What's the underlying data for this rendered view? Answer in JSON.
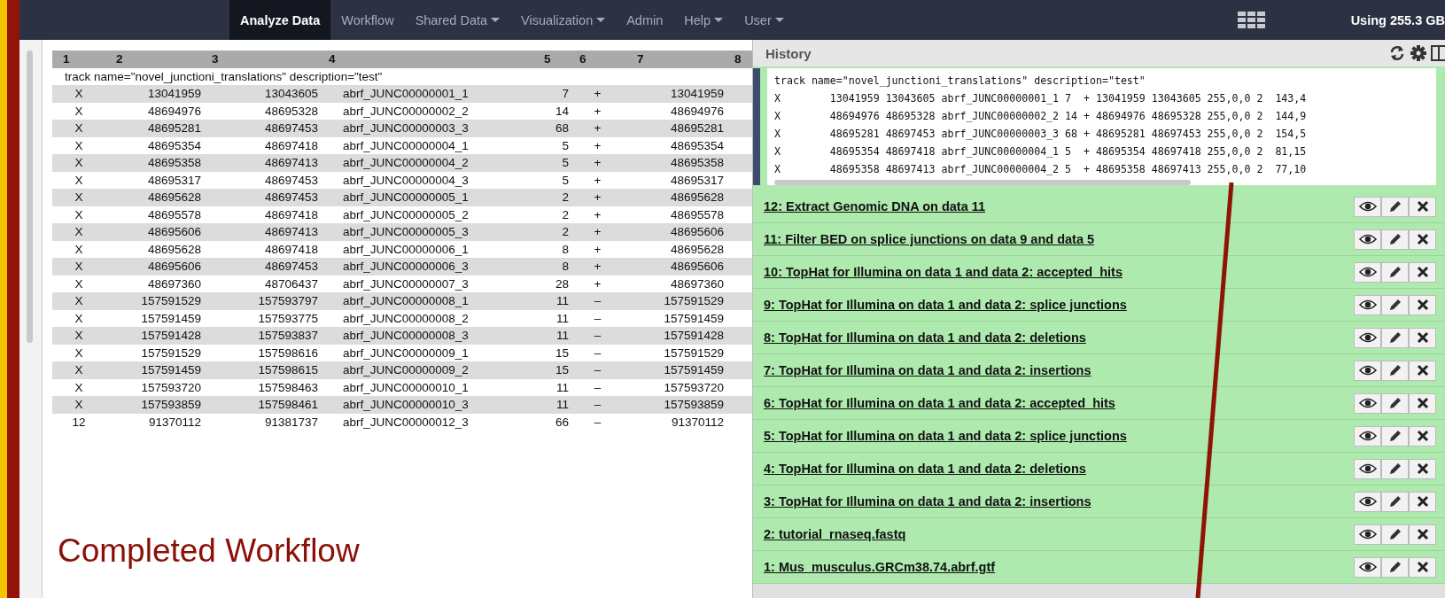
{
  "nav": {
    "items": [
      {
        "label": "Analyze Data",
        "selected": true,
        "dropdown": false
      },
      {
        "label": "Workflow",
        "selected": false,
        "dropdown": false
      },
      {
        "label": "Shared Data",
        "selected": false,
        "dropdown": true
      },
      {
        "label": "Visualization",
        "selected": false,
        "dropdown": true
      },
      {
        "label": "Admin",
        "selected": false,
        "dropdown": false
      },
      {
        "label": "Help",
        "selected": false,
        "dropdown": true
      },
      {
        "label": "User",
        "selected": false,
        "dropdown": true
      }
    ],
    "usage": "Using 255.3 GB"
  },
  "table": {
    "columns": [
      "1",
      "2",
      "3",
      "4",
      "5",
      "6",
      "7",
      "8"
    ],
    "track_line": "track name=\"novel_junctioni_translations\" description=\"test\"",
    "rows": [
      [
        "X",
        "13041959",
        "13043605",
        "abrf_JUNC00000001_1",
        "7",
        "+",
        "13041959"
      ],
      [
        "X",
        "48694976",
        "48695328",
        "abrf_JUNC00000002_2",
        "14",
        "+",
        "48694976"
      ],
      [
        "X",
        "48695281",
        "48697453",
        "abrf_JUNC00000003_3",
        "68",
        "+",
        "48695281"
      ],
      [
        "X",
        "48695354",
        "48697418",
        "abrf_JUNC00000004_1",
        "5",
        "+",
        "48695354"
      ],
      [
        "X",
        "48695358",
        "48697413",
        "abrf_JUNC00000004_2",
        "5",
        "+",
        "48695358"
      ],
      [
        "X",
        "48695317",
        "48697453",
        "abrf_JUNC00000004_3",
        "5",
        "+",
        "48695317"
      ],
      [
        "X",
        "48695628",
        "48697453",
        "abrf_JUNC00000005_1",
        "2",
        "+",
        "48695628"
      ],
      [
        "X",
        "48695578",
        "48697418",
        "abrf_JUNC00000005_2",
        "2",
        "+",
        "48695578"
      ],
      [
        "X",
        "48695606",
        "48697413",
        "abrf_JUNC00000005_3",
        "2",
        "+",
        "48695606"
      ],
      [
        "X",
        "48695628",
        "48697418",
        "abrf_JUNC00000006_1",
        "8",
        "+",
        "48695628"
      ],
      [
        "X",
        "48695606",
        "48697453",
        "abrf_JUNC00000006_3",
        "8",
        "+",
        "48695606"
      ],
      [
        "X",
        "48697360",
        "48706437",
        "abrf_JUNC00000007_3",
        "28",
        "+",
        "48697360"
      ],
      [
        "X",
        "157591529",
        "157593797",
        "abrf_JUNC00000008_1",
        "11",
        "–",
        "157591529"
      ],
      [
        "X",
        "157591459",
        "157593775",
        "abrf_JUNC00000008_2",
        "11",
        "–",
        "157591459"
      ],
      [
        "X",
        "157591428",
        "157593837",
        "abrf_JUNC00000008_3",
        "11",
        "–",
        "157591428"
      ],
      [
        "X",
        "157591529",
        "157598616",
        "abrf_JUNC00000009_1",
        "15",
        "–",
        "157591529"
      ],
      [
        "X",
        "157591459",
        "157598615",
        "abrf_JUNC00000009_2",
        "15",
        "–",
        "157591459"
      ],
      [
        "X",
        "157593720",
        "157598463",
        "abrf_JUNC00000010_1",
        "11",
        "–",
        "157593720"
      ],
      [
        "X",
        "157593859",
        "157598461",
        "abrf_JUNC00000010_3",
        "11",
        "–",
        "157593859"
      ],
      [
        "12",
        "91370112",
        "91381737",
        "abrf_JUNC00000012_3",
        "66",
        "–",
        "91370112"
      ]
    ]
  },
  "caption": "Completed Workflow",
  "history": {
    "title": "History",
    "preview": [
      "track name=\"novel_junctioni_translations\" description=\"test\"",
      "X        13041959 13043605 abrf_JUNC00000001_1 7  + 13041959 13043605 255,0,0 2  143,4",
      "X        48694976 48695328 abrf_JUNC00000002_2 14 + 48694976 48695328 255,0,0 2  144,9",
      "X        48695281 48697453 abrf_JUNC00000003_3 68 + 48695281 48697453 255,0,0 2  154,5",
      "X        48695354 48697418 abrf_JUNC00000004_1 5  + 48695354 48697418 255,0,0 2  81,15",
      "X        48695358 48697413 abrf_JUNC00000004_2 5  + 48695358 48697413 255,0,0 2  77,10"
    ],
    "items": [
      {
        "label": "12: Extract Genomic DNA on data 11"
      },
      {
        "label": "11: Filter BED on splice junctions on data 9 and data 5"
      },
      {
        "label": "10: TopHat for Illumina on data 1 and data 2: accepted_hits"
      },
      {
        "label": "9: TopHat for Illumina on data 1 and data 2: splice junctions"
      },
      {
        "label": "8: TopHat for Illumina on data 1 and data 2: deletions"
      },
      {
        "label": "7: TopHat for Illumina on data 1 and data 2: insertions"
      },
      {
        "label": "6: TopHat for Illumina on data 1 and data 2: accepted_hits"
      },
      {
        "label": "5: TopHat for Illumina on data 1 and data 2: splice junctions"
      },
      {
        "label": "4: TopHat for Illumina on data 1 and data 2: deletions"
      },
      {
        "label": "3: TopHat for Illumina on data 1 and data 2: insertions"
      },
      {
        "label": "2: tutorial_rnaseq.fastq"
      },
      {
        "label": "1: Mus_musculus.GRCm38.74.abrf.gtf"
      }
    ]
  }
}
